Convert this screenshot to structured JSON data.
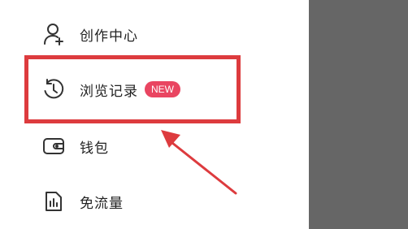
{
  "menu": {
    "items": [
      {
        "label": "创作中心",
        "icon": "user-plus-icon"
      },
      {
        "label": "浏览记录",
        "icon": "clock-history-icon",
        "badge": "NEW"
      },
      {
        "label": "钱包",
        "icon": "wallet-icon"
      },
      {
        "label": "免流量",
        "icon": "data-sim-icon"
      }
    ]
  },
  "annotation": {
    "color": "#dd3b3e"
  },
  "colors": {
    "badge": "#e94561",
    "side_panel": "#666666",
    "text": "#222222"
  }
}
